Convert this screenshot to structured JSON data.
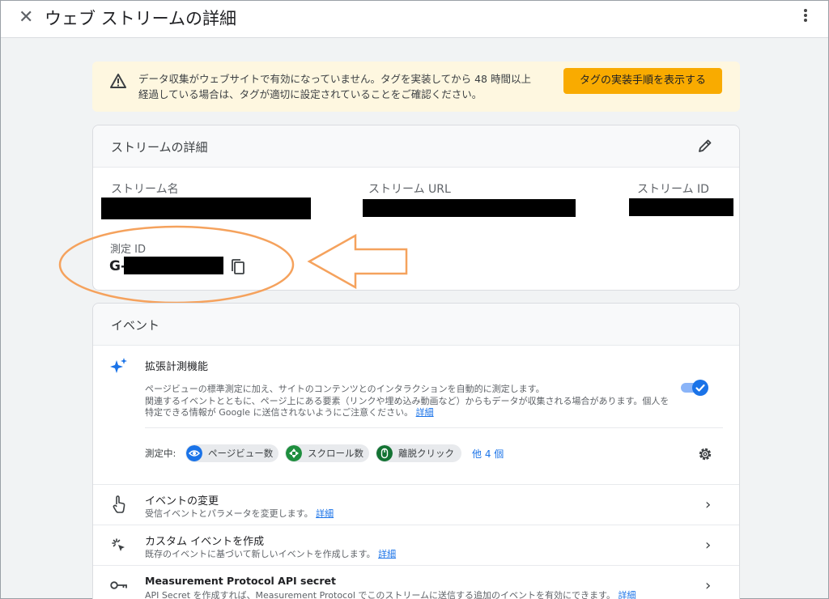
{
  "header": {
    "close_glyph": "✕",
    "title": "ウェブ ストリームの詳細"
  },
  "banner": {
    "message_line1": "データ収集がウェブサイトで有効になっていません。タグを実装してから 48 時間以上",
    "message_line2": "経過している場合は、タグが適切に設定されていることをご確認ください。",
    "button_label": "タグの実装手順を表示する"
  },
  "stream_details": {
    "heading": "ストリームの詳細",
    "stream_name_label": "ストリーム名",
    "stream_url_label": "ストリーム URL",
    "stream_id_label": "ストリーム ID",
    "measurement_id_label": "測定 ID",
    "measurement_id_prefix": "G-"
  },
  "events": {
    "heading": "イベント",
    "enhanced": {
      "title": "拡張計測機能",
      "desc_line1": "ページビューの標準測定に加え、サイトのコンテンツとのインタラクションを自動的に測定します。",
      "desc_line2": "関連するイベントとともに、ページ上にある要素（リンクや埋め込み動画など）からもデータが収集される場合があります。個人を",
      "desc_line3": "特定できる情報が Google に送信されないようにご注意ください。",
      "desc_link": "詳細",
      "measuring_label": "測定中:",
      "chips": [
        "ページビュー数",
        "スクロール数",
        "離脱クリック"
      ],
      "more": "他 4 個"
    },
    "rows": [
      {
        "title": "イベントの変更",
        "sub": "受信イベントとパラメータを変更します。",
        "link": "詳細"
      },
      {
        "title": "カスタム イベントを作成",
        "sub": "既存のイベントに基づいて新しいイベントを作成します。",
        "link": "詳細"
      },
      {
        "title": "Measurement Protocol API secret",
        "sub": "API Secret を作成すれば、Measurement Protocol でこのストリームに送信する追加のイベントを有効にできます。",
        "link": "詳細"
      }
    ]
  },
  "colors": {
    "accent": "#1a73e8",
    "banner_bg": "#fef7e0",
    "banner_button": "#f9ab00",
    "annotation": "#f5a25d"
  }
}
